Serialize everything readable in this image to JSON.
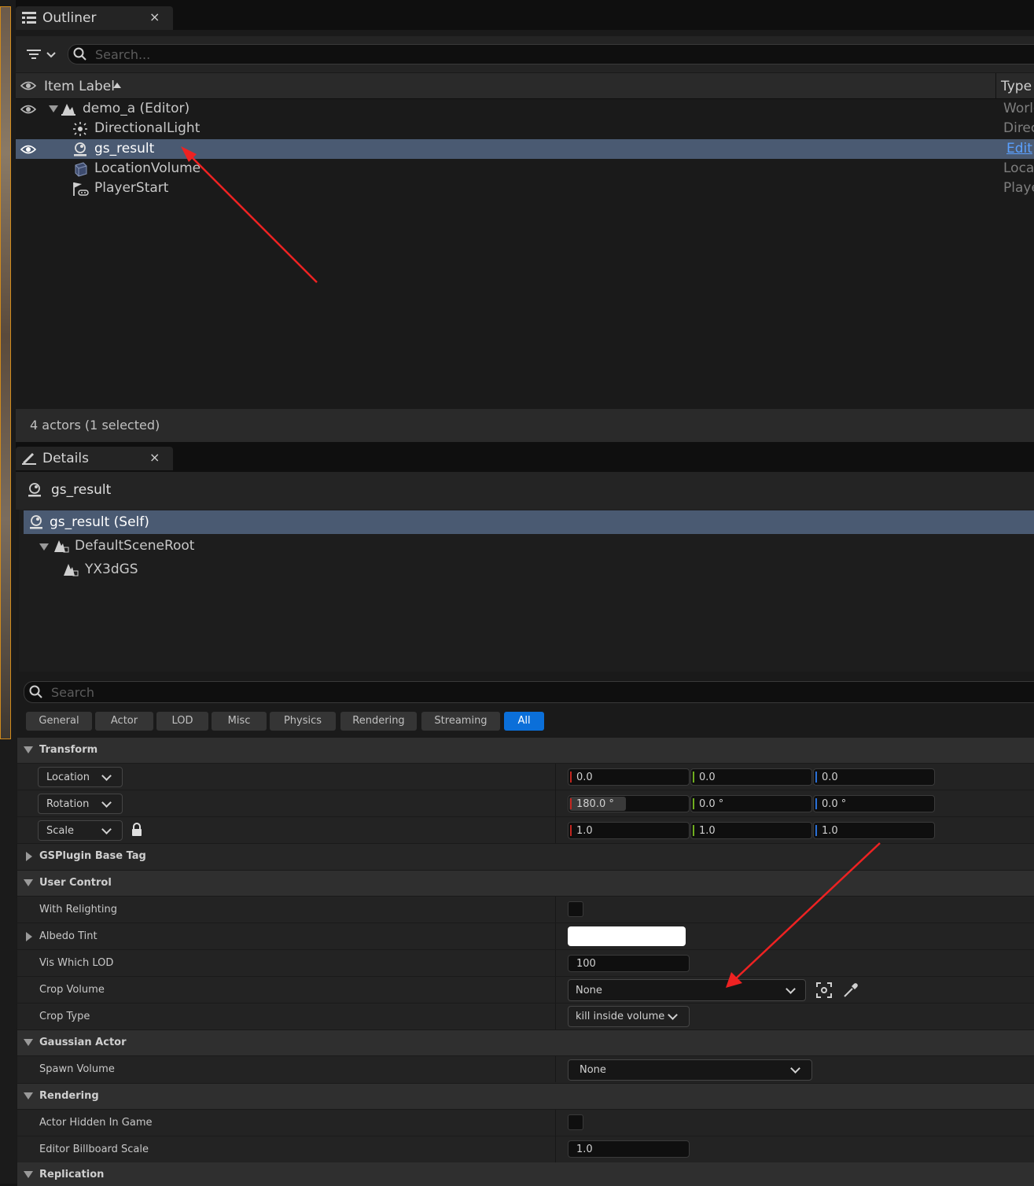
{
  "outliner": {
    "tab_title": "Outliner",
    "tab_close": "×",
    "search_placeholder": "Search...",
    "col_item_label": "Item Label",
    "col_type": "Type",
    "rows": [
      {
        "label": "demo_a (Editor)",
        "type": "Worlc"
      },
      {
        "label": "DirectionalLight",
        "type": "Direc"
      },
      {
        "label": "gs_result",
        "type": "Edit"
      },
      {
        "label": "LocationVolume",
        "type": "Loca"
      },
      {
        "label": "PlayerStart",
        "type": "Playe"
      }
    ],
    "footer": "4 actors (1 selected)"
  },
  "details": {
    "tab_title": "Details",
    "tab_close": "×",
    "actor_name": "gs_result",
    "components": [
      {
        "label": "gs_result (Self)"
      },
      {
        "label": "DefaultSceneRoot"
      },
      {
        "label": "YX3dGS"
      }
    ],
    "search_placeholder": "Search",
    "filters": [
      "General",
      "Actor",
      "LOD",
      "Misc",
      "Physics",
      "Rendering",
      "Streaming",
      "All"
    ],
    "active_filter": "All",
    "transform": {
      "section": "Transform",
      "location": {
        "label": "Location",
        "x": "0.0",
        "y": "0.0",
        "z": "0.0"
      },
      "rotation": {
        "label": "Rotation",
        "x": "180.0 °",
        "y": "0.0 °",
        "z": "0.0 °"
      },
      "scale": {
        "label": "Scale",
        "x": "1.0",
        "y": "1.0",
        "z": "1.0"
      }
    },
    "gsplugin_section": "GSPlugin Base Tag",
    "user_control": {
      "section": "User Control",
      "with_relighting": "With Relighting",
      "albedo_tint": "Albedo Tint",
      "albedo_color": "#ffffff",
      "vis_which_lod": "Vis Which LOD",
      "vis_which_lod_value": "100",
      "crop_volume": "Crop Volume",
      "crop_volume_value": "None",
      "crop_type": "Crop Type",
      "crop_type_value": "kill inside volume"
    },
    "gaussian_actor": {
      "section": "Gaussian Actor",
      "spawn_volume": "Spawn Volume",
      "spawn_volume_value": "None"
    },
    "rendering": {
      "section": "Rendering",
      "actor_hidden": "Actor Hidden In Game",
      "billboard_scale": "Editor Billboard Scale",
      "billboard_scale_value": "1.0"
    },
    "replication_section": "Replication"
  },
  "colors": {
    "selection": "#4a5a72",
    "accent_blue": "#0b6fd9",
    "annotation_arrow": "#ee2222",
    "axis_x": "#c2261f",
    "axis_y": "#6fae1f",
    "axis_z": "#2a6fd6"
  }
}
